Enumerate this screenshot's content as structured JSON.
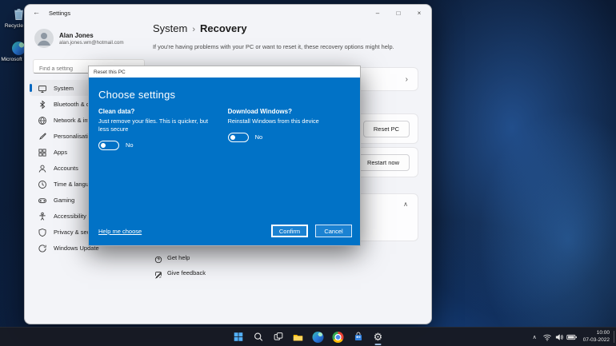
{
  "colors": {
    "accent": "#0067c0",
    "dialog_blue": "#0172c6",
    "taskbar_background": "#181b24"
  },
  "icons": {
    "back": "←",
    "minimize": "–",
    "maximize": "□",
    "close": "×",
    "chevron_right": "›",
    "chevron_up": "∧",
    "tray_chevron": "∧",
    "settings_gear": "⚙"
  },
  "desktop": {
    "icons": [
      {
        "label": "Recycle Bin",
        "icon": "recycle-bin-icon"
      },
      {
        "label": "Microsoft Edge",
        "icon": "edge-icon"
      }
    ]
  },
  "window": {
    "titlebar": {
      "title": "Settings"
    },
    "user": {
      "name": "Alan Jones",
      "email": "alan.jones.wm@hotmail.com"
    },
    "search": {
      "placeholder": "Find a setting"
    },
    "nav": [
      {
        "label": "System",
        "icon": "monitor-icon",
        "selected": true
      },
      {
        "label": "Bluetooth & devices",
        "icon": "bluetooth-icon"
      },
      {
        "label": "Network & internet",
        "icon": "globe-icon"
      },
      {
        "label": "Personalisation",
        "icon": "brush-icon"
      },
      {
        "label": "Apps",
        "icon": "apps-grid-icon"
      },
      {
        "label": "Accounts",
        "icon": "person-icon"
      },
      {
        "label": "Time & language",
        "icon": "clock-icon"
      },
      {
        "label": "Gaming",
        "icon": "gamepad-icon"
      },
      {
        "label": "Accessibility",
        "icon": "accessibility-icon"
      },
      {
        "label": "Privacy & security",
        "icon": "shield-icon"
      },
      {
        "label": "Windows Update",
        "icon": "update-icon"
      }
    ]
  },
  "main": {
    "breadcrumb": {
      "root": "System",
      "separator": "›",
      "current": "Recovery"
    },
    "description": "If you're having problems with your PC or want to reset it, these recovery options might help.",
    "reset_row": {
      "button": "Reset PC"
    },
    "restart_row": {
      "button": "Restart now"
    },
    "links": [
      {
        "label": "Get help",
        "icon": "help-icon"
      },
      {
        "label": "Give feedback",
        "icon": "feedback-icon"
      }
    ]
  },
  "dialog": {
    "title": "Reset this PC",
    "heading": "Choose settings",
    "options": [
      {
        "title": "Clean data?",
        "description": "Just remove your files. This is quicker, but less secure",
        "toggle_state": "off",
        "toggle_label": "No"
      },
      {
        "title": "Download Windows?",
        "description": "Reinstall Windows from this device",
        "toggle_state": "off",
        "toggle_label": "No"
      }
    ],
    "help_link": "Help me choose",
    "buttons": {
      "confirm": "Confirm",
      "cancel": "Cancel"
    }
  },
  "taskbar": {
    "tray": {
      "time": "10:00",
      "date": "07-03-2022"
    }
  }
}
